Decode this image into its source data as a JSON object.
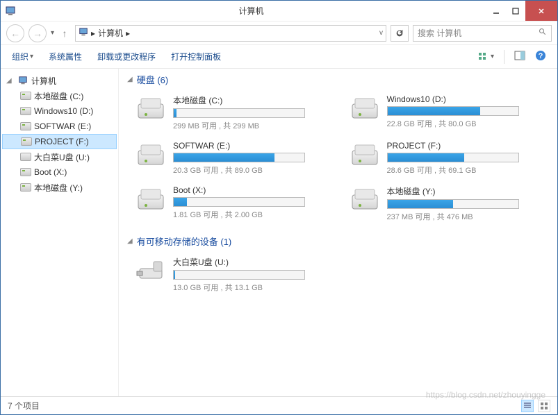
{
  "window": {
    "title": "计算机"
  },
  "navbar": {
    "breadcrumb": "计算机",
    "search_placeholder": "搜索 计算机"
  },
  "toolbar": {
    "organize": "组织",
    "system_props": "系统属性",
    "uninstall": "卸载或更改程序",
    "control_panel": "打开控制面板"
  },
  "sidebar": {
    "root": "计算机",
    "items": [
      {
        "label": "本地磁盘 (C:)",
        "type": "hdd"
      },
      {
        "label": "Windows10 (D:)",
        "type": "hdd"
      },
      {
        "label": "SOFTWAR (E:)",
        "type": "hdd"
      },
      {
        "label": "PROJECT (F:)",
        "type": "hdd",
        "selected": true
      },
      {
        "label": "大白菜U盘 (U:)",
        "type": "usb"
      },
      {
        "label": "Boot (X:)",
        "type": "hdd"
      },
      {
        "label": "本地磁盘 (Y:)",
        "type": "hdd"
      }
    ]
  },
  "groups": [
    {
      "title": "硬盘 (6)",
      "drives": [
        {
          "name": "本地磁盘 (C:)",
          "free": "299 MB",
          "total": "299 MB",
          "fill_pct": 2
        },
        {
          "name": "Windows10 (D:)",
          "free": "22.8 GB",
          "total": "80.0 GB",
          "fill_pct": 71
        },
        {
          "name": "SOFTWAR (E:)",
          "free": "20.3 GB",
          "total": "89.0 GB",
          "fill_pct": 77
        },
        {
          "name": "PROJECT (F:)",
          "free": "28.6 GB",
          "total": "69.1 GB",
          "fill_pct": 59
        },
        {
          "name": "Boot (X:)",
          "free": "1.81 GB",
          "total": "2.00 GB",
          "fill_pct": 10
        },
        {
          "name": "本地磁盘 (Y:)",
          "free": "237 MB",
          "total": "476 MB",
          "fill_pct": 50
        }
      ]
    },
    {
      "title": "有可移动存储的设备 (1)",
      "drives": [
        {
          "name": "大白菜U盘 (U:)",
          "free": "13.0 GB",
          "total": "13.1 GB",
          "fill_pct": 1,
          "removable": true
        }
      ]
    }
  ],
  "statusbar": {
    "text": "7 个项目"
  },
  "stats_template": {
    "free_label": "可用",
    "sep": " , 共 "
  },
  "watermark": "https://blog.csdn.net/zhouyingge"
}
